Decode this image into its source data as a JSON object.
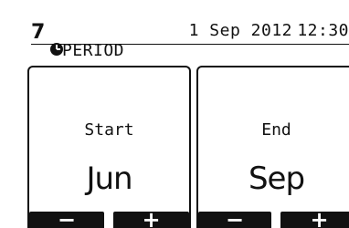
{
  "header": {
    "period_number": "7",
    "title": "PERIOD",
    "date": "1 Sep 2012",
    "time": "12:30"
  },
  "icons": {
    "period": "clock-icon"
  },
  "start_panel": {
    "label": "Start",
    "value": "Jun",
    "minus_label": "−",
    "plus_label": "+"
  },
  "end_panel": {
    "label": "End",
    "value": "Sep",
    "minus_label": "−",
    "plus_label": "+"
  }
}
